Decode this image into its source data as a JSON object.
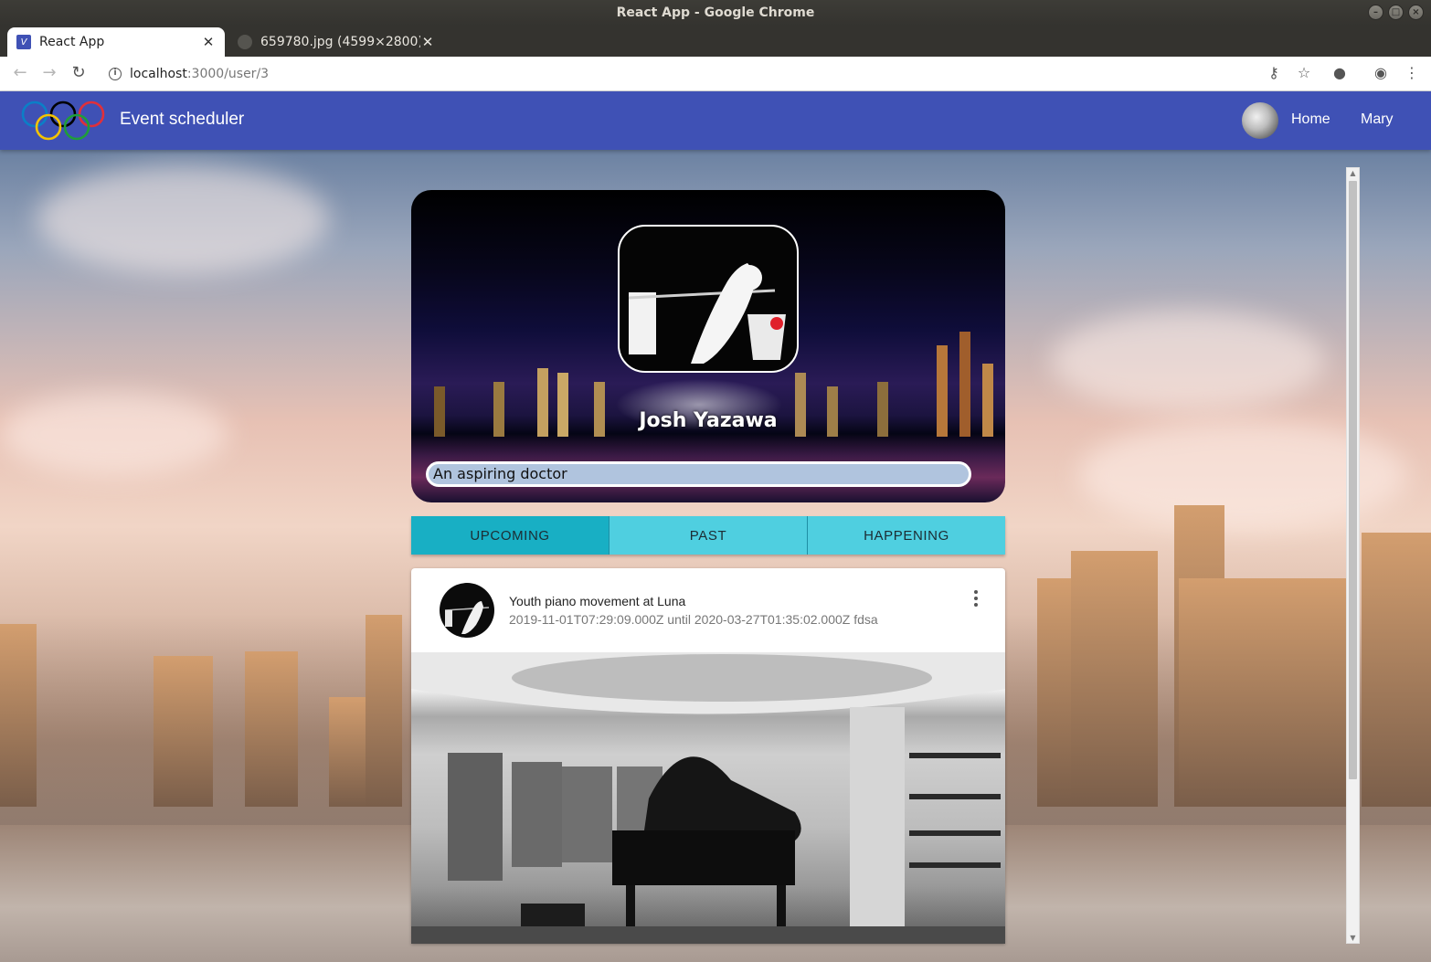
{
  "window": {
    "title": "React App - Google Chrome"
  },
  "tabs": [
    {
      "title": "React App",
      "active": true
    },
    {
      "title": "659780.jpg (4599×2800)",
      "active": false
    }
  ],
  "address_bar": {
    "host": "localhost",
    "path": ":3000/user/3"
  },
  "app": {
    "title": "Event scheduler",
    "nav": {
      "home": "Home",
      "user": "Mary"
    }
  },
  "profile": {
    "name": "Josh Yazawa",
    "bio": "An aspiring doctor"
  },
  "event_tabs": [
    {
      "label": "UPCOMING",
      "selected": true
    },
    {
      "label": "PAST",
      "selected": false
    },
    {
      "label": "HAPPENING",
      "selected": false
    }
  ],
  "event": {
    "title": "Youth piano movement at Luna",
    "subtitle": "2019-11-01T07:29:09.000Z until 2020-03-27T01:35:02.000Z fdsa"
  },
  "colors": {
    "appbar": "#3f51b5",
    "tab": "#4fcfe0",
    "tab_selected": "#18afc4",
    "bio_field": "#b0c4de"
  }
}
